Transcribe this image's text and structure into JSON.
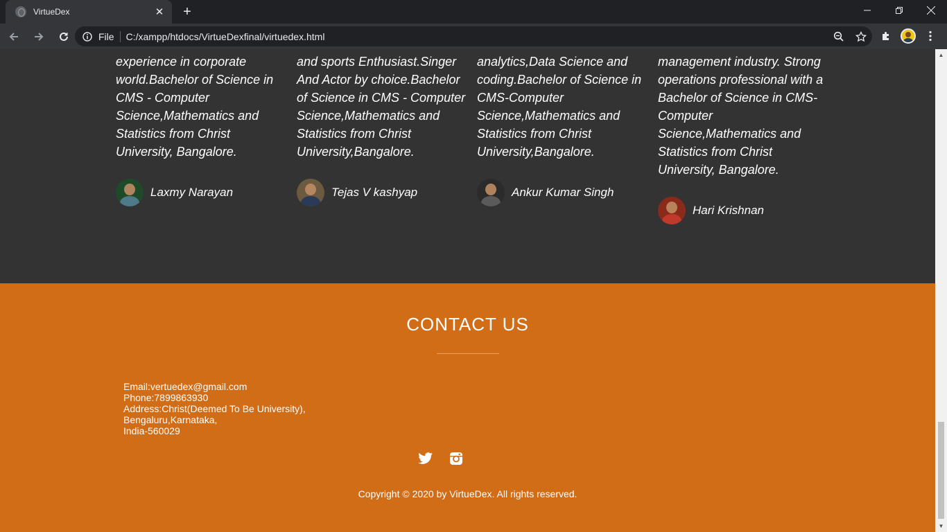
{
  "browser": {
    "tab_title": "VirtueDex",
    "new_tab_symbol": "+",
    "omnibox_scheme": "File",
    "url": "C:/xampp/htdocs/VirtueDexfinal/virtuedex.html"
  },
  "team": {
    "members": [
      {
        "bio": "experience in corporate world.Bachelor of Science in CMS - Computer Science,Mathematics and Statistics from Christ University, Bangalore.",
        "name": "Laxmy Narayan",
        "avatar_icon": "person-photo"
      },
      {
        "bio": "and sports Enthusiast.Singer And Actor by choice.Bachelor of Science in CMS - Computer Science,Mathematics and Statistics from Christ University,Bangalore.",
        "name": "Tejas V kashyap",
        "avatar_icon": "person-photo"
      },
      {
        "bio": "analytics,Data Science and coding.Bachelor of Science in CMS-Computer Science,Mathematics and Statistics from Christ University,Bangalore.",
        "name": "Ankur Kumar Singh",
        "avatar_icon": "person-photo"
      },
      {
        "bio": "management industry. Strong operations professional with a Bachelor of Science in CMS-Computer Science,Mathematics and Statistics from Christ University, Bangalore.",
        "name": "Hari Krishnan",
        "avatar_icon": "person-photo"
      }
    ]
  },
  "contact": {
    "title": "CONTACT US",
    "email": "Email:vertuedex@gmail.com",
    "phone": "Phone:7899863930",
    "address_line1": "Address:Christ(Deemed To Be University),",
    "address_line2": "Bengaluru,Karnataka,",
    "address_line3": "India-560029",
    "socials": [
      "twitter-icon",
      "instagram-icon"
    ],
    "copyright": "Copyright © 2020 by VirtueDex. All rights reserved."
  },
  "colors": {
    "team_bg": "#333333",
    "contact_bg": "#d16c17",
    "chrome_dark": "#202124",
    "chrome_toolbar": "#35363a"
  }
}
